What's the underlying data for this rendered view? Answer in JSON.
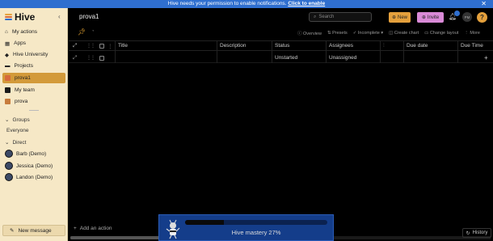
{
  "banner": {
    "text": "Hive needs your permission to enable notifications.",
    "link": "Click to enable",
    "close_icon": "close-icon"
  },
  "sidebar": {
    "logo_text": "Hive",
    "logo_colors": [
      "#e6a23c",
      "#d76a3c",
      "#2f6fcf"
    ],
    "items": [
      {
        "label": "My actions",
        "icon": "home-icon"
      },
      {
        "label": "Apps",
        "icon": "grid-icon"
      },
      {
        "label": "Hive University",
        "icon": "graduation-icon"
      },
      {
        "label": "Projects",
        "icon": "folder-icon"
      },
      {
        "label": "prova1",
        "icon": "project-square-icon",
        "active": true
      },
      {
        "label": "My team",
        "icon": "project-square-icon"
      },
      {
        "label": "prova",
        "icon": "project-square-icon"
      }
    ],
    "groups_label": "Groups",
    "everyone_label": "Everyone",
    "direct_label": "Direct",
    "people": [
      "Barb (Demo)",
      "Jessica (Demo)",
      "Landon (Demo)"
    ],
    "new_message_label": "New message"
  },
  "header": {
    "title": "prova1",
    "search_placeholder": "Search",
    "new_label": "New",
    "invite_label": "Invite",
    "user_initials": "PM",
    "help_label": "?"
  },
  "toolbar": {
    "items": [
      "Overview",
      "Presets",
      "Incomplete",
      "Create chart",
      "Change layout",
      "More"
    ]
  },
  "table": {
    "headers": [
      "Title",
      "Description",
      "Status",
      "Assignees",
      "Due date",
      "Due Time"
    ],
    "rows": [
      {
        "title": "",
        "description": "",
        "status": "Unstarted",
        "assignees": "Unassigned",
        "due_date": "",
        "due_time": ""
      }
    ]
  },
  "footer": {
    "add_action_label": "Add an action",
    "history_label": "History"
  },
  "mastery": {
    "text": "Hive mastery 27%",
    "progress": 0.27
  }
}
